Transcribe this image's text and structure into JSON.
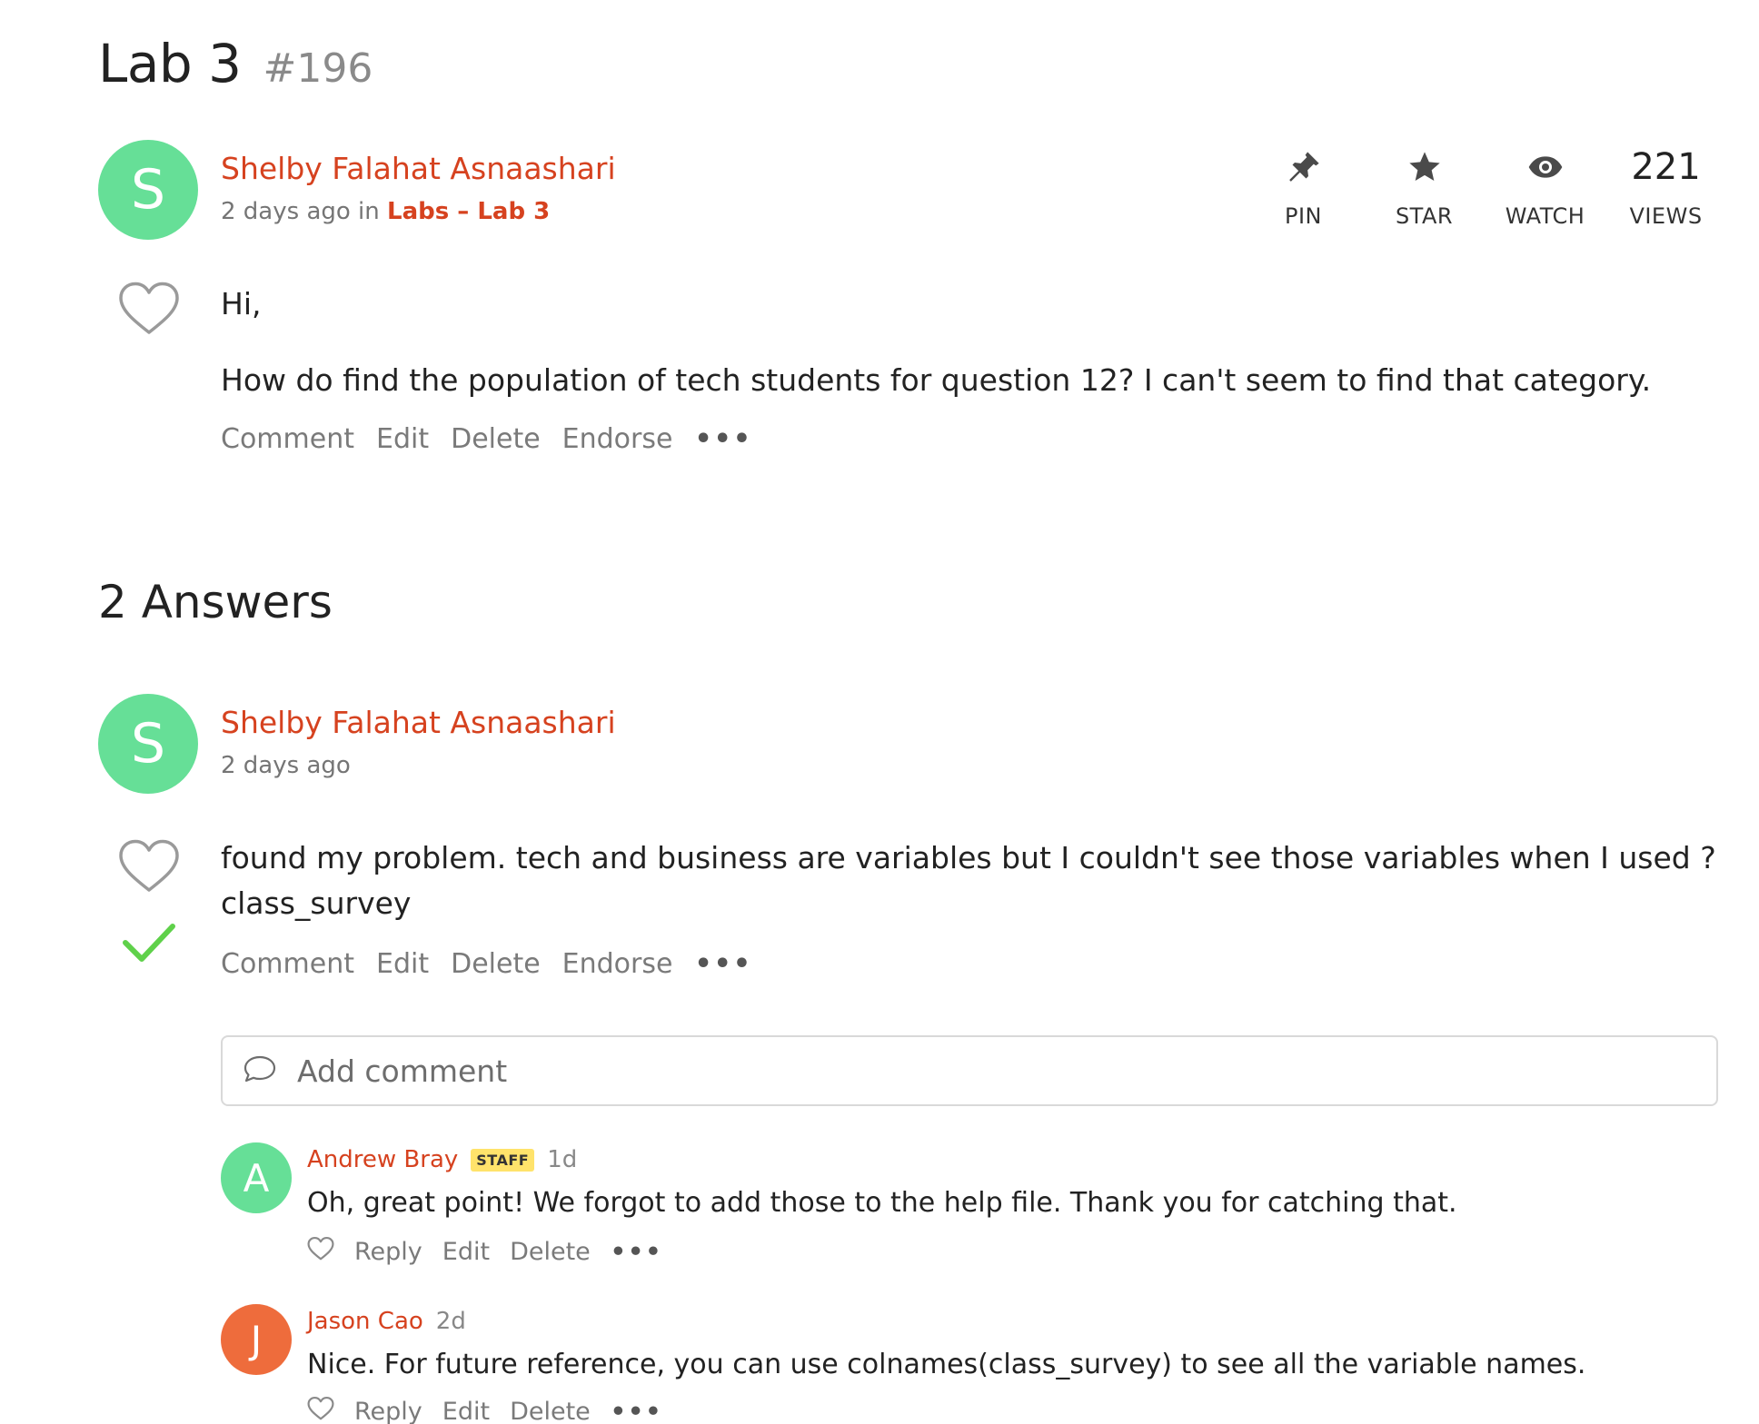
{
  "post": {
    "title": "Lab 3",
    "number": "#196",
    "avatar_letter": "S",
    "author": "Shelby Falahat Asnaashari",
    "time_prefix": "2 days ago in",
    "category": "Labs – Lab 3",
    "actions": {
      "pin": "PIN",
      "star": "STAR",
      "watch": "WATCH",
      "views_count": "221",
      "views_label": "VIEWS"
    },
    "body": [
      "Hi,",
      "How do find the population of tech students for question 12? I can't seem to find that category."
    ],
    "links": {
      "comment": "Comment",
      "edit": "Edit",
      "delete": "Delete",
      "endorse": "Endorse",
      "more": "•••"
    }
  },
  "answers_heading": "2 Answers",
  "answer": {
    "avatar_letter": "S",
    "author": "Shelby Falahat Asnaashari",
    "time": "2 days ago",
    "body_line1": "found my problem. tech and business are variables but I couldn't see those variables when I used ?",
    "body_line2": "class_survey",
    "links": {
      "comment": "Comment",
      "edit": "Edit",
      "delete": "Delete",
      "endorse": "Endorse",
      "more": "•••"
    },
    "accepted": true
  },
  "comment_input": {
    "placeholder": "Add comment"
  },
  "comments": [
    {
      "avatar_letter": "A",
      "author": "Andrew Bray",
      "badge": "STAFF",
      "time": "1d",
      "text": "Oh, great point! We forgot to add those to the help file. Thank you for catching that.",
      "links": {
        "reply": "Reply",
        "edit": "Edit",
        "delete": "Delete",
        "more": "•••"
      }
    },
    {
      "avatar_letter": "J",
      "author": "Jason Cao",
      "time": "2d",
      "text": "Nice. For future reference, you can use colnames(class_survey) to see all the variable names.",
      "links": {
        "reply": "Reply",
        "edit": "Edit",
        "delete": "Delete",
        "more": "•••"
      }
    }
  ],
  "colors": {
    "accent": "#d6421f",
    "avatar_green": "#66df97",
    "avatar_orange": "#ee6c3c",
    "check_green": "#5fd14a",
    "staff_badge": "#ffe36b"
  }
}
